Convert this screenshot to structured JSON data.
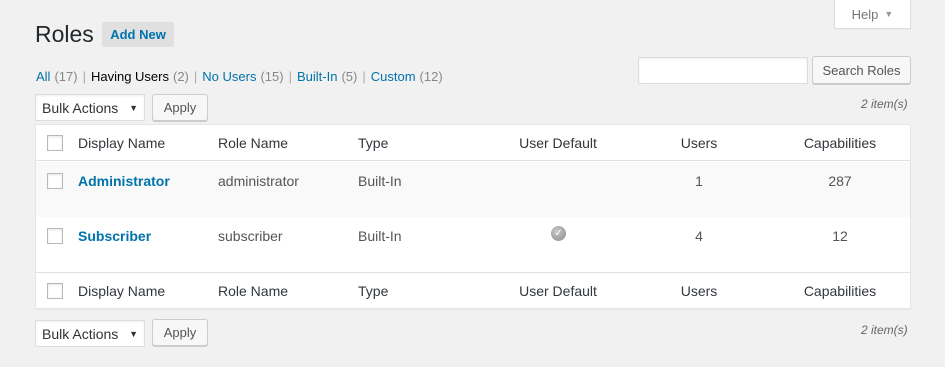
{
  "help": {
    "label": "Help",
    "caret": "▼"
  },
  "header": {
    "title": "Roles",
    "add_new": "Add New"
  },
  "filters": [
    {
      "label": "All",
      "count": "(17)",
      "current": false
    },
    {
      "label": "Having Users",
      "count": "(2)",
      "current": true
    },
    {
      "label": "No Users",
      "count": "(15)",
      "current": false
    },
    {
      "label": "Built-In",
      "count": "(5)",
      "current": false
    },
    {
      "label": "Custom",
      "count": "(12)",
      "current": false
    }
  ],
  "search": {
    "value": "",
    "button": "Search Roles"
  },
  "bulk": {
    "selected": "Bulk Actions",
    "apply": "Apply"
  },
  "item_count": "2 item(s)",
  "columns": [
    "Display Name",
    "Role Name",
    "Type",
    "User Default",
    "Users",
    "Capabilities"
  ],
  "rows": [
    {
      "display_name": "Administrator",
      "role_name": "administrator",
      "type": "Built-In",
      "user_default": false,
      "users": "1",
      "capabilities": "287"
    },
    {
      "display_name": "Subscriber",
      "role_name": "subscriber",
      "type": "Built-In",
      "user_default": true,
      "users": "4",
      "capabilities": "12"
    }
  ],
  "icons": {
    "default_check": "check-circle-icon"
  },
  "colors": {
    "link": "#0073aa",
    "background": "#f1f1f1",
    "row_alt": "#f9f9f9"
  }
}
